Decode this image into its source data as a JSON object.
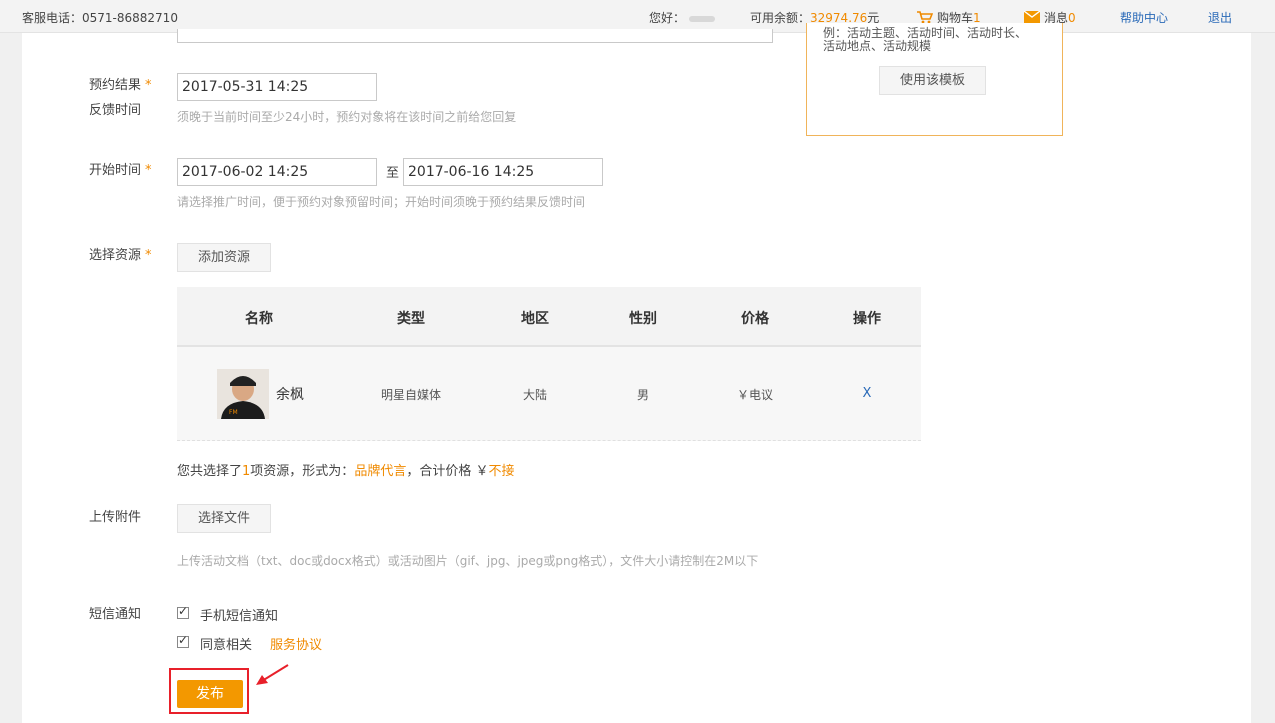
{
  "topbar": {
    "hotline": "客服电话：0571-86882710",
    "greeting": "您好：",
    "balance_label": "可用余额：",
    "balance_value": "32974.76",
    "balance_unit": "元",
    "cart_label": "购物车",
    "cart_count": "1",
    "msg_label": "消息",
    "msg_count": "0",
    "help": "帮助中心",
    "logout": "退出"
  },
  "template_box": {
    "text_line1": "例：活动主题、活动时间、活动时长、",
    "text_line2": "活动地点、活动规模",
    "use_button": "使用该模板"
  },
  "form": {
    "feedback_label_1": "预约结果",
    "feedback_label_2": "反馈时间",
    "feedback_value": "2017-05-31 14:25",
    "feedback_hint": "须晚于当前时间至少24小时，预约对象将在该时间之前给您回复",
    "start_label": "开始时间",
    "start_from": "2017-06-02 14:25",
    "range_sep": "至",
    "start_to": "2017-06-16 14:25",
    "start_hint": "请选择推广时间，便于预约对象预留时间；开始时间须晚于预约结果反馈时间",
    "resource_label": "选择资源",
    "add_resource_button": "添加资源",
    "upload_label": "上传附件",
    "choose_file_button": "选择文件",
    "upload_hint": "上传活动文档（txt、doc或docx格式）或活动图片（gif、jpg、jpeg或png格式），文件大小请控制在2M以下",
    "sms_label": "短信通知",
    "sms_checkbox": "手机短信通知",
    "agree_checkbox": "同意相关",
    "agreement_link": "服务协议",
    "publish_button": "发布"
  },
  "table": {
    "headers": [
      "名称",
      "类型",
      "地区",
      "性别",
      "价格",
      "操作"
    ],
    "rows": [
      {
        "name": "余枫",
        "type": "明星自媒体",
        "region": "大陆",
        "gender": "男",
        "price": "￥电议",
        "action": "X"
      }
    ]
  },
  "summary": {
    "prefix": "您共选择了",
    "count": "1",
    "middle": "项资源，形式为：",
    "form": "品牌代言",
    "total_label": "，合计价格 ￥",
    "total_value": "不接"
  },
  "colors": {
    "accent": "#f08a00",
    "link": "#2a6ab8",
    "highlight": "#e8202a"
  }
}
